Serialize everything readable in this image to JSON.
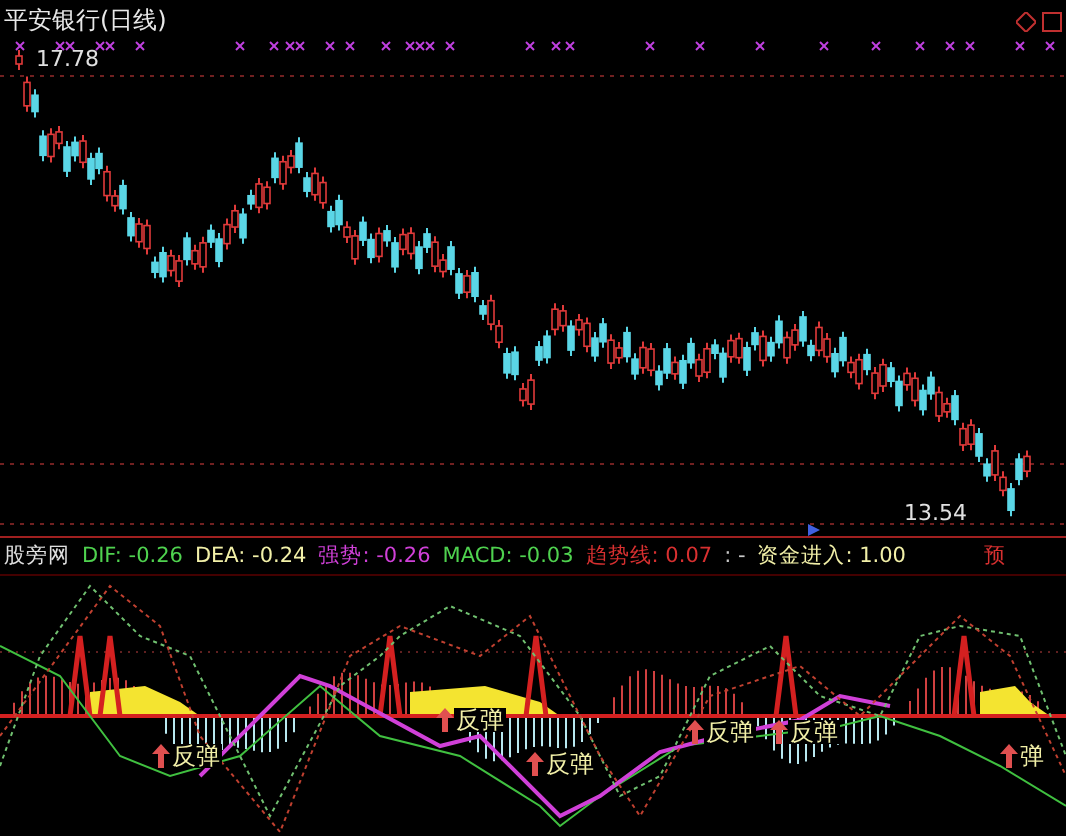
{
  "main_panel": {
    "title": "平安银行(日线)",
    "high_label": "17.78",
    "low_label": "13.54"
  },
  "indicator": {
    "name": "股旁网",
    "legend": [
      {
        "label": "DIF: -0.26",
        "color": "#4fd24f"
      },
      {
        "label": "DEA: -0.24",
        "color": "#f2f0a8"
      },
      {
        "label": "强势: -0.26",
        "color": "#d040d8"
      },
      {
        "label": "MACD: -0.03",
        "color": "#4fd24f"
      },
      {
        "label": "趋势线: 0.07",
        "color": "#d83030"
      },
      {
        "label": ": -",
        "color": "#c8c8c8"
      },
      {
        "label": "资金进入: 1.00",
        "color": "#f2f0a8"
      }
    ],
    "flag": "预",
    "signals": [
      {
        "label": "反弹"
      },
      {
        "label": "反弹"
      },
      {
        "label": "反弹"
      },
      {
        "label": "反弹"
      },
      {
        "label": "反弹"
      },
      {
        "label": "弹"
      }
    ]
  }
}
